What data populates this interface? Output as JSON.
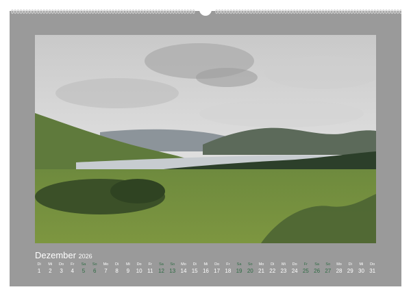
{
  "calendar": {
    "month": "Dezember",
    "year": "2026",
    "days": [
      {
        "wd": "Di",
        "n": "1",
        "weekend": false
      },
      {
        "wd": "Mi",
        "n": "2",
        "weekend": false
      },
      {
        "wd": "Do",
        "n": "3",
        "weekend": false
      },
      {
        "wd": "Fr",
        "n": "4",
        "weekend": false
      },
      {
        "wd": "Sa",
        "n": "5",
        "weekend": true
      },
      {
        "wd": "So",
        "n": "6",
        "weekend": true
      },
      {
        "wd": "Mo",
        "n": "7",
        "weekend": false
      },
      {
        "wd": "Di",
        "n": "8",
        "weekend": false
      },
      {
        "wd": "Mi",
        "n": "9",
        "weekend": false
      },
      {
        "wd": "Do",
        "n": "10",
        "weekend": false
      },
      {
        "wd": "Fr",
        "n": "11",
        "weekend": false
      },
      {
        "wd": "Sa",
        "n": "12",
        "weekend": true
      },
      {
        "wd": "So",
        "n": "13",
        "weekend": true
      },
      {
        "wd": "Mo",
        "n": "14",
        "weekend": false
      },
      {
        "wd": "Di",
        "n": "15",
        "weekend": false
      },
      {
        "wd": "Mi",
        "n": "16",
        "weekend": false
      },
      {
        "wd": "Do",
        "n": "17",
        "weekend": false
      },
      {
        "wd": "Fr",
        "n": "18",
        "weekend": false
      },
      {
        "wd": "Sa",
        "n": "19",
        "weekend": true
      },
      {
        "wd": "So",
        "n": "20",
        "weekend": true
      },
      {
        "wd": "Mo",
        "n": "21",
        "weekend": false
      },
      {
        "wd": "Di",
        "n": "22",
        "weekend": false
      },
      {
        "wd": "Mi",
        "n": "23",
        "weekend": false
      },
      {
        "wd": "Do",
        "n": "24",
        "weekend": false
      },
      {
        "wd": "Fr",
        "n": "25",
        "weekend": true
      },
      {
        "wd": "Sa",
        "n": "26",
        "weekend": true
      },
      {
        "wd": "So",
        "n": "27",
        "weekend": true
      },
      {
        "wd": "Mo",
        "n": "28",
        "weekend": false
      },
      {
        "wd": "Di",
        "n": "29",
        "weekend": false
      },
      {
        "wd": "Mi",
        "n": "30",
        "weekend": false
      },
      {
        "wd": "Do",
        "n": "31",
        "weekend": false
      }
    ]
  },
  "colors": {
    "page_background": "#9a9a9a",
    "text": "#ffffff",
    "weekend_text": "#2f6b44"
  },
  "photo": {
    "subject": "landscape-photo"
  }
}
